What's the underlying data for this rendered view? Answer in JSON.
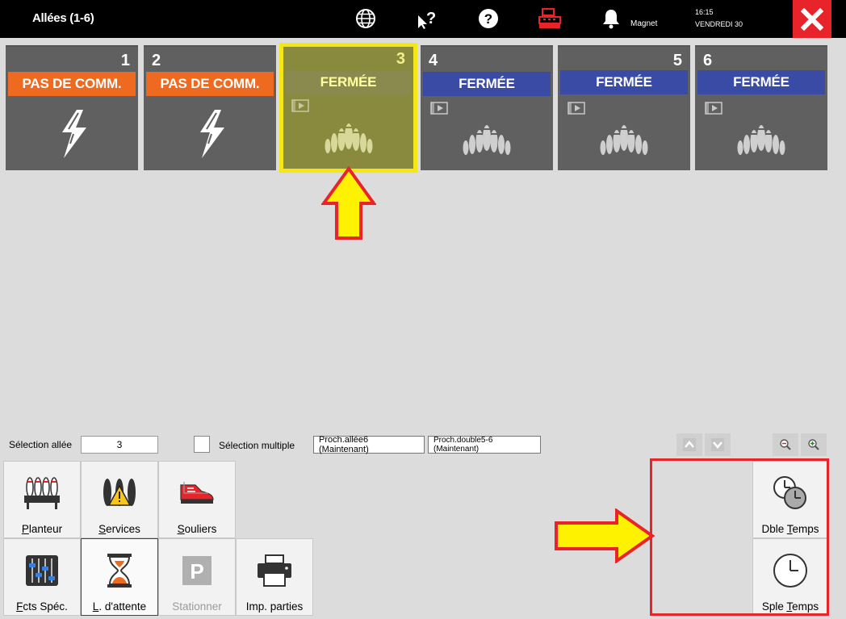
{
  "header": {
    "title": "Allées (1-6)",
    "user": "Magnet",
    "time": "16:15",
    "date": "VENDREDI 30",
    "close_icon": "close-icon"
  },
  "lanes": [
    {
      "number": "1",
      "status": "PAS DE COMM.",
      "status_color": "#ee6a21",
      "icon": "lightning-icon"
    },
    {
      "number": "2",
      "status": "PAS DE COMM.",
      "status_color": "#ee6a21",
      "icon": "lightning-icon"
    },
    {
      "number": "3",
      "status": "FERMÉE",
      "status_color": "#8a8a4e",
      "icon": "bowling-pins-icon",
      "selected": true
    },
    {
      "number": "4",
      "status": "FERMÉE",
      "status_color": "#3a4ba6",
      "icon": "bowling-pins-icon"
    },
    {
      "number": "5",
      "status": "FERMÉE",
      "status_color": "#3a4ba6",
      "icon": "bowling-pins-icon"
    },
    {
      "number": "6",
      "status": "FERMÉE",
      "status_color": "#3a4ba6",
      "icon": "bowling-pins-icon"
    }
  ],
  "controls": {
    "selection_label": "Sélection allée",
    "selection_value": "3",
    "multiple_label": "Sélection multiple",
    "next_lane_btn": "Proch.allée6 (Maintenant)",
    "next_double_btn": "Proch.double5-6 (Maintenant)"
  },
  "tools": {
    "planteur": {
      "first": "P",
      "rest": "lanteur"
    },
    "services": {
      "first": "S",
      "rest": "ervices"
    },
    "souliers": {
      "first": "S",
      "rest": "ouliers"
    },
    "fcts": {
      "first": "F",
      "rest": "cts Spéc."
    },
    "attente": {
      "first": "L",
      "rest": ". d'attente"
    },
    "stationner": {
      "first": "",
      "rest": "Stationner"
    },
    "imp": {
      "first": "",
      "rest": "Imp. parties"
    },
    "dble": {
      "pre": "Dble ",
      "first": "T",
      "rest": "emps"
    },
    "sple": {
      "pre": "Sple ",
      "first": "T",
      "rest": "emps"
    }
  },
  "colors": {
    "accent_red": "#e8232a",
    "highlight_yellow": "#f5e717",
    "orange": "#ee6a21",
    "blue": "#3a4ba6"
  }
}
